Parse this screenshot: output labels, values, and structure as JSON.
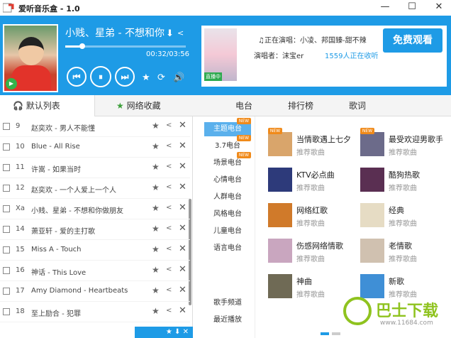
{
  "window": {
    "title": "爱听音乐盒 - 1.0",
    "minimize": "—",
    "maximize": "☐",
    "close": "✕"
  },
  "player": {
    "song_title": "小贱、星弟 - 不想和你",
    "time": "00:32/03:56",
    "progress": 0.14,
    "prev": "⏮",
    "pause": "⏸",
    "next": "⏭",
    "fav": "★",
    "repeat": "⟳",
    "volume": "🔊"
  },
  "promo": {
    "status": "♫正在演唱：小凌、邦国臻-甜不辣",
    "singer": "演唱者：沫宝er",
    "listeners": "1559人正在收听",
    "watch_label": "免费观看",
    "badge": "直播中"
  },
  "left_tabs": {
    "default_list": "默认列表",
    "net_fav": "网络收藏"
  },
  "right_tabs": {
    "radio": "电台",
    "chart": "排行榜",
    "lyrics": "歌词"
  },
  "playlist": [
    {
      "num": "9",
      "name": "赵奕欢 - 男人不能懂"
    },
    {
      "num": "10",
      "name": "Blue - All Rise"
    },
    {
      "num": "11",
      "name": "许嵩 - 如果当时"
    },
    {
      "num": "12",
      "name": "赵奕欢 - 一个人爱上一个人"
    },
    {
      "num": "Xa",
      "name": "小贱、星弟 - 不想和你做朋友"
    },
    {
      "num": "14",
      "name": "萧亚轩 - 爱的主打歌"
    },
    {
      "num": "15",
      "name": "Miss A - Touch"
    },
    {
      "num": "16",
      "name": "神话 - This Love"
    },
    {
      "num": "17",
      "name": "Amy Diamond - Heartbeats"
    },
    {
      "num": "18",
      "name": "至上励合 - 犯罪"
    }
  ],
  "stations": [
    "主题电台",
    "3.7电台",
    "场景电台",
    "心情电台",
    "人群电台",
    "风格电台",
    "儿童电台",
    "语言电台"
  ],
  "stations_bottom": [
    "歌手频道",
    "最近播放"
  ],
  "new_label": "NEW",
  "grid": [
    {
      "title": "当情歌遇上七夕",
      "sub": "推荐歌曲",
      "new": true,
      "color": "#d9a56b"
    },
    {
      "title": "最受欢迎男歌手",
      "sub": "推荐歌曲",
      "new": true,
      "color": "#6c6b8a"
    },
    {
      "title": "KTV必点曲",
      "sub": "推荐歌曲",
      "new": false,
      "color": "#2d3a7a"
    },
    {
      "title": "酷狗热歌",
      "sub": "推荐歌曲",
      "new": false,
      "color": "#5a2f52"
    },
    {
      "title": "网络红歌",
      "sub": "推荐歌曲",
      "new": false,
      "color": "#d07a2a"
    },
    {
      "title": "经典",
      "sub": "推荐歌曲",
      "new": false,
      "color": "#e6dcc4"
    },
    {
      "title": "伤感网络情歌",
      "sub": "推荐歌曲",
      "new": false,
      "color": "#c9a6bf"
    },
    {
      "title": "老情歌",
      "sub": "推荐歌曲",
      "new": false,
      "color": "#d0c1b0"
    },
    {
      "title": "神曲",
      "sub": "推荐歌曲",
      "new": false,
      "color": "#6f6a55"
    },
    {
      "title": "新歌",
      "sub": "推荐歌曲",
      "new": false,
      "color": "#3f8fd6"
    }
  ],
  "watermark": {
    "text": "巴士下载",
    "url": "www.11684.com"
  }
}
